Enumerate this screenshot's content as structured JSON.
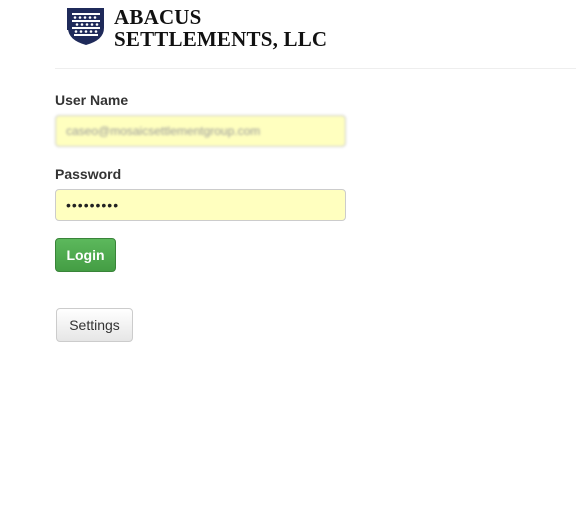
{
  "brand": {
    "line1": "ABACUS",
    "line2": "SETTLEMENTS, LLC",
    "logo_icon": "shield-crest-icon"
  },
  "login_form": {
    "username_label": "User Name",
    "username_value": "caseo@mosaicsettlementgroup.com",
    "password_label": "Password",
    "password_value": "•••••••••",
    "login_label": "Login",
    "settings_label": "Settings"
  },
  "colors": {
    "login_button": "#449d44",
    "autofill_bg": "#ffffbf",
    "logo_navy": "#1f2a5a"
  }
}
